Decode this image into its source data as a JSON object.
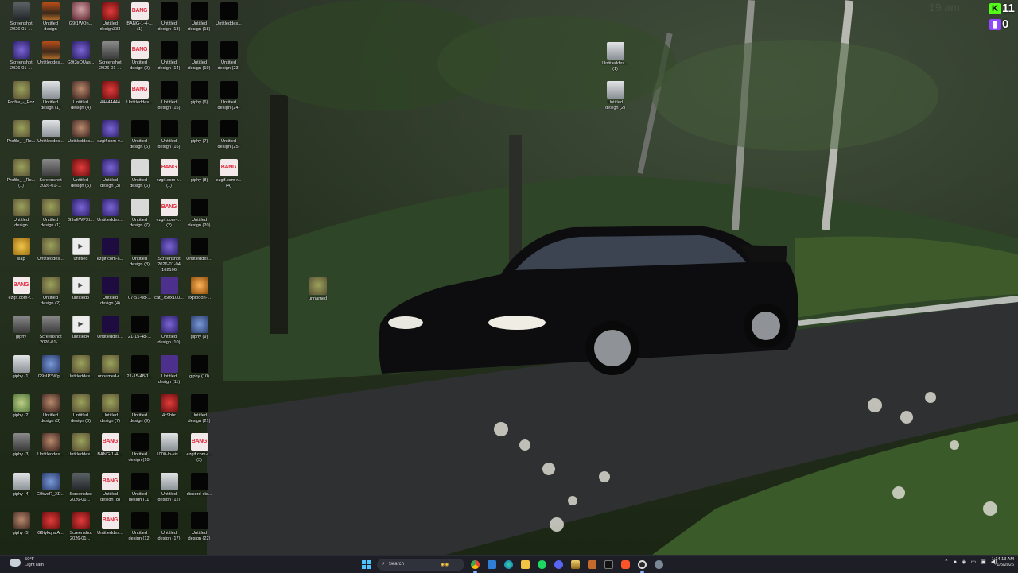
{
  "desktop": {
    "icons": [
      {
        "label": "Screenshot\n2026-01-...",
        "thumb": "t-ss",
        "col": 0,
        "row": 0
      },
      {
        "label": "Untitled\ndesign",
        "thumb": "t-sky",
        "col": 1,
        "row": 0
      },
      {
        "label": "G9t1WQh...",
        "thumb": "t-pink",
        "col": 2,
        "row": 0
      },
      {
        "label": "Untitled\ndesign333",
        "thumb": "t-red",
        "col": 3,
        "row": 0
      },
      {
        "label": "BANG-1-4-...\n(1)",
        "thumb": "t-bang",
        "col": 4,
        "row": 0,
        "text": "BANG"
      },
      {
        "label": "Untitled\ndesign (13)",
        "thumb": "t-dark",
        "col": 5,
        "row": 0
      },
      {
        "label": "Untitled\ndesign (18)",
        "thumb": "t-dark",
        "col": 6,
        "row": 0
      },
      {
        "label": "Untitleddes...",
        "thumb": "t-dark",
        "col": 7,
        "row": 0
      },
      {
        "label": "Screenshot\n2026-01-...",
        "thumb": "t-purple",
        "col": 0,
        "row": 1
      },
      {
        "label": "Untitleddes...",
        "thumb": "t-sky",
        "col": 1,
        "row": 1
      },
      {
        "label": "G9t3sOUas...",
        "thumb": "t-purple",
        "col": 2,
        "row": 1
      },
      {
        "label": "Screenshot\n2026-01-...",
        "thumb": "t-grey",
        "col": 3,
        "row": 1
      },
      {
        "label": "Untitled\ndesign (9)",
        "thumb": "t-bang",
        "col": 4,
        "row": 1,
        "text": "BANG"
      },
      {
        "label": "Untitled\ndesign (14)",
        "thumb": "t-dark",
        "col": 5,
        "row": 1
      },
      {
        "label": "Untitled\ndesign (19)",
        "thumb": "t-dark",
        "col": 6,
        "row": 1
      },
      {
        "label": "Untitled\ndesign (23)",
        "thumb": "t-dark",
        "col": 7,
        "row": 1
      },
      {
        "label": "Profile_-_Roz",
        "thumb": "t-shrek",
        "col": 0,
        "row": 2
      },
      {
        "label": "Untitled\ndesign (1)",
        "thumb": "t-light",
        "col": 1,
        "row": 2
      },
      {
        "label": "Untitled\ndesign (4)",
        "thumb": "t-face",
        "col": 2,
        "row": 2
      },
      {
        "label": "44444444",
        "thumb": "t-red",
        "col": 3,
        "row": 2
      },
      {
        "label": "Untitleddes...",
        "thumb": "t-bang",
        "col": 4,
        "row": 2,
        "text": "BANG"
      },
      {
        "label": "Untitled\ndesign (15)",
        "thumb": "t-dark",
        "col": 5,
        "row": 2
      },
      {
        "label": "giphy (6)",
        "thumb": "t-dark",
        "col": 6,
        "row": 2
      },
      {
        "label": "Untitled\ndesign (24)",
        "thumb": "t-dark",
        "col": 7,
        "row": 2
      },
      {
        "label": "Profile_-_Ro...",
        "thumb": "t-shrek",
        "col": 0,
        "row": 3
      },
      {
        "label": "Untitleddes...",
        "thumb": "t-light",
        "col": 1,
        "row": 3
      },
      {
        "label": "Untitleddes...",
        "thumb": "t-face",
        "col": 2,
        "row": 3
      },
      {
        "label": "ezgif.com-v...",
        "thumb": "t-purple",
        "col": 3,
        "row": 3
      },
      {
        "label": "Untitled\ndesign (5)",
        "thumb": "t-dark",
        "col": 4,
        "row": 3
      },
      {
        "label": "Untitled\ndesign (16)",
        "thumb": "t-dark",
        "col": 5,
        "row": 3
      },
      {
        "label": "giphy (7)",
        "thumb": "t-dark",
        "col": 6,
        "row": 3
      },
      {
        "label": "Untitled\ndesign (25)",
        "thumb": "t-dark",
        "col": 7,
        "row": 3
      },
      {
        "label": "Profile_-_Ro...\n(1)",
        "thumb": "t-shrek",
        "col": 0,
        "row": 4
      },
      {
        "label": "Screenshot\n2026-01-...",
        "thumb": "t-grey",
        "col": 1,
        "row": 4
      },
      {
        "label": "Untitled\ndesign (5)",
        "thumb": "t-red",
        "col": 2,
        "row": 4
      },
      {
        "label": "Untitled\ndesign (3)",
        "thumb": "t-purple",
        "col": 3,
        "row": 4
      },
      {
        "label": "Untitled\ndesign (6)",
        "thumb": "t-white",
        "col": 4,
        "row": 4
      },
      {
        "label": "ezgif.com-r...\n(1)",
        "thumb": "t-bang",
        "col": 5,
        "row": 4,
        "text": "BANG"
      },
      {
        "label": "giphy (8)",
        "thumb": "t-dark",
        "col": 6,
        "row": 4
      },
      {
        "label": "ezgif.com-r...\n(4)",
        "thumb": "t-bang",
        "col": 7,
        "row": 4,
        "text": "BANG"
      },
      {
        "label": "Untitled\ndesign",
        "thumb": "t-shrek",
        "col": 0,
        "row": 5
      },
      {
        "label": "Untitled\ndesign (1)",
        "thumb": "t-shrek",
        "col": 1,
        "row": 5
      },
      {
        "label": "G9sEWPXt...",
        "thumb": "t-purple",
        "col": 2,
        "row": 5
      },
      {
        "label": "Untitleddes...",
        "thumb": "t-purple",
        "col": 3,
        "row": 5
      },
      {
        "label": "Untitled\ndesign (7)",
        "thumb": "t-white",
        "col": 4,
        "row": 5
      },
      {
        "label": "ezgif.com-r...\n(2)",
        "thumb": "t-bang",
        "col": 5,
        "row": 5,
        "text": "BANG"
      },
      {
        "label": "Untitled\ndesign (20)",
        "thumb": "t-dark",
        "col": 6,
        "row": 5
      },
      {
        "label": "slap",
        "thumb": "t-gold",
        "col": 0,
        "row": 6
      },
      {
        "label": "Untitleddes...",
        "thumb": "t-shrek",
        "col": 1,
        "row": 6
      },
      {
        "label": "untitled",
        "thumb": "t-media",
        "col": 2,
        "row": 6
      },
      {
        "label": "ezgif.com-a...",
        "thumb": "t-purple2",
        "col": 3,
        "row": 6
      },
      {
        "label": "Untitled\ndesign (8)",
        "thumb": "t-dark",
        "col": 4,
        "row": 6
      },
      {
        "label": "Screenshot\n2026-01-04\n162106",
        "thumb": "t-purple",
        "col": 5,
        "row": 6
      },
      {
        "label": "Untitleddes...",
        "thumb": "t-dark",
        "col": 6,
        "row": 6
      },
      {
        "label": "ezgif.com-r...",
        "thumb": "t-bang",
        "col": 0,
        "row": 7,
        "text": "BANG"
      },
      {
        "label": "Untitled\ndesign (2)",
        "thumb": "t-shrek",
        "col": 1,
        "row": 7
      },
      {
        "label": "untitled3",
        "thumb": "t-media",
        "col": 2,
        "row": 7
      },
      {
        "label": "Untitled\ndesign (4)",
        "thumb": "t-purple2",
        "col": 3,
        "row": 7
      },
      {
        "label": "07-51-08-...",
        "thumb": "t-dark",
        "col": 4,
        "row": 7
      },
      {
        "label": "cat_750x100...",
        "thumb": "t-twitch",
        "col": 5,
        "row": 7
      },
      {
        "label": "explodon-...",
        "thumb": "t-orange",
        "col": 6,
        "row": 7
      },
      {
        "label": "giphy",
        "thumb": "t-grey",
        "col": 0,
        "row": 8
      },
      {
        "label": "Screenshot\n2026-01-...",
        "thumb": "t-grey",
        "col": 1,
        "row": 8
      },
      {
        "label": "untitled4",
        "thumb": "t-media",
        "col": 2,
        "row": 8
      },
      {
        "label": "Untitleddes...",
        "thumb": "t-purple2",
        "col": 3,
        "row": 8
      },
      {
        "label": "21-15-48-...",
        "thumb": "t-dark",
        "col": 4,
        "row": 8
      },
      {
        "label": "Untitled\ndesign (10)",
        "thumb": "t-purple",
        "col": 5,
        "row": 8
      },
      {
        "label": "giphy (9)",
        "thumb": "t-blue",
        "col": 6,
        "row": 8
      },
      {
        "label": "giphy (1)",
        "thumb": "t-light",
        "col": 0,
        "row": 9
      },
      {
        "label": "G9sIP3Wg...",
        "thumb": "t-blue",
        "col": 1,
        "row": 9
      },
      {
        "label": "Untitleddes...",
        "thumb": "t-shrek",
        "col": 2,
        "row": 9
      },
      {
        "label": "unnamed-r...",
        "thumb": "t-shrek",
        "col": 3,
        "row": 9
      },
      {
        "label": "21-15-48-1...",
        "thumb": "t-dark",
        "col": 4,
        "row": 9
      },
      {
        "label": "Untitled\ndesign (11)",
        "thumb": "t-twitch",
        "col": 5,
        "row": 9
      },
      {
        "label": "giphy (10)",
        "thumb": "t-dark",
        "col": 6,
        "row": 9
      },
      {
        "label": "giphy (2)",
        "thumb": "t-globe",
        "col": 0,
        "row": 10
      },
      {
        "label": "Untitled\ndesign (3)",
        "thumb": "t-face",
        "col": 1,
        "row": 10
      },
      {
        "label": "Untitled\ndesign (6)",
        "thumb": "t-shrek",
        "col": 2,
        "row": 10
      },
      {
        "label": "Untitled\ndesign (7)",
        "thumb": "t-shrek",
        "col": 3,
        "row": 10
      },
      {
        "label": "Untitled\ndesign (9)",
        "thumb": "t-dark",
        "col": 4,
        "row": 10
      },
      {
        "label": "4c9bhr",
        "thumb": "t-red",
        "col": 5,
        "row": 10
      },
      {
        "label": "Untitled\ndesign (21)",
        "thumb": "t-dark",
        "col": 6,
        "row": 10
      },
      {
        "label": "giphy (3)",
        "thumb": "t-grey",
        "col": 0,
        "row": 11
      },
      {
        "label": "Untitleddes...",
        "thumb": "t-face",
        "col": 1,
        "row": 11
      },
      {
        "label": "Untitleddes...",
        "thumb": "t-shrek",
        "col": 2,
        "row": 11
      },
      {
        "label": "BANG-1-4-...",
        "thumb": "t-bang",
        "col": 3,
        "row": 11,
        "text": "BANG"
      },
      {
        "label": "Untitled\ndesign (10)",
        "thumb": "t-dark",
        "col": 4,
        "row": 11
      },
      {
        "label": "1000-lb-sis...",
        "thumb": "t-light",
        "col": 5,
        "row": 11
      },
      {
        "label": "ezgif.com-r...\n(3)",
        "thumb": "t-bang",
        "col": 6,
        "row": 11,
        "text": "BANG"
      },
      {
        "label": "giphy (4)",
        "thumb": "t-light",
        "col": 0,
        "row": 12
      },
      {
        "label": "G9twqR_XE...",
        "thumb": "t-blue",
        "col": 1,
        "row": 12
      },
      {
        "label": "Screenshot\n2026-01-...",
        "thumb": "t-ss",
        "col": 2,
        "row": 12
      },
      {
        "label": "Untitled\ndesign (8)",
        "thumb": "t-bang",
        "col": 3,
        "row": 12,
        "text": "BANG"
      },
      {
        "label": "Untitled\ndesign (11)",
        "thumb": "t-dark",
        "col": 4,
        "row": 12
      },
      {
        "label": "Untitled\ndesign (12)",
        "thumb": "t-light",
        "col": 5,
        "row": 12
      },
      {
        "label": "discord-dis...",
        "thumb": "t-dark",
        "col": 6,
        "row": 12
      },
      {
        "label": "giphy (5)",
        "thumb": "t-face",
        "col": 0,
        "row": 13
      },
      {
        "label": "G9tykqraIA...",
        "thumb": "t-red",
        "col": 1,
        "row": 13
      },
      {
        "label": "Screenshot\n2026-01-...",
        "thumb": "t-red",
        "col": 2,
        "row": 13
      },
      {
        "label": "Untitleddes...",
        "thumb": "t-bang",
        "col": 3,
        "row": 13,
        "text": "BANG"
      },
      {
        "label": "Untitled\ndesign (12)",
        "thumb": "t-dark",
        "col": 4,
        "row": 13
      },
      {
        "label": "Untitled\ndesign (17)",
        "thumb": "t-dark",
        "col": 5,
        "row": 13
      },
      {
        "label": "Untitled\ndesign (22)",
        "thumb": "t-dark",
        "col": 6,
        "row": 13
      }
    ],
    "floating_icons": [
      {
        "label": "Untitleddes...\n(1)",
        "thumb": "t-light",
        "name": "desktop-icon-untitleddes-1"
      },
      {
        "label": "Untitled\ndesign (2)",
        "thumb": "t-light",
        "name": "desktop-icon-untitled-design-2-right"
      },
      {
        "label": "unnamed",
        "thumb": "t-shrek",
        "name": "desktop-icon-unnamed"
      }
    ]
  },
  "overlay": {
    "ghost_time": "19 am",
    "kick_count": "11",
    "twitch_count": "0",
    "kick_color": "#53fc18",
    "twitch_color": "#9146ff"
  },
  "taskbar": {
    "weather_temp": "50°F",
    "weather_desc": "Light rain",
    "search_placeholder": "Search",
    "apps": [
      "chrome-icon",
      "edge-icon",
      "file-explorer-icon",
      "spotify-icon",
      "discord-icon",
      "vpn-icon",
      "gimp-icon",
      "terminal-icon",
      "brave-icon",
      "obs-icon",
      "settings-icon"
    ],
    "clock_time": "1:14:13 AM",
    "clock_date": "1/5/2026"
  }
}
